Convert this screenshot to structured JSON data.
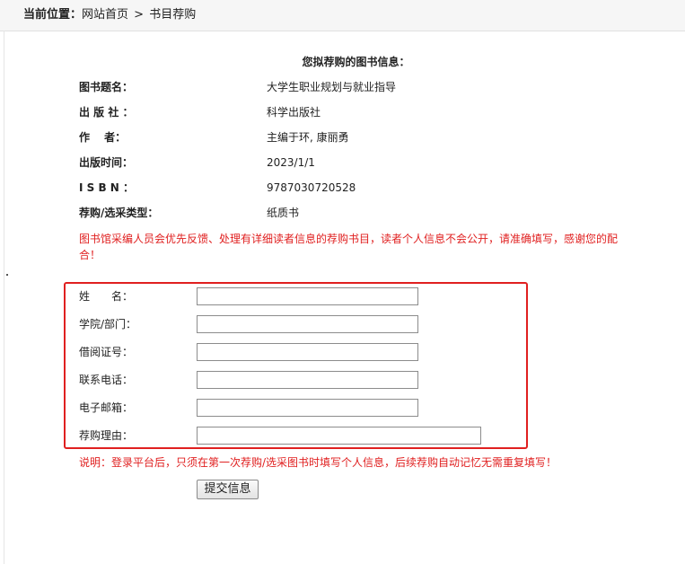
{
  "breadcrumb": {
    "label": "当前位置：",
    "home": "网站首页",
    "separator": ">",
    "current": "书目荐购"
  },
  "book_info": {
    "title": "您拟荐购的图书信息：",
    "rows": [
      {
        "label": "图书题名：",
        "value": "大学生职业规划与就业指导"
      },
      {
        "label": "出 版 社 ：",
        "value": "科学出版社"
      },
      {
        "label": "作　 者：",
        "value": "主编于环, 康丽勇"
      },
      {
        "label": "出版时间：",
        "value": "2023/1/1"
      },
      {
        "label": "I S B N ：",
        "value": "9787030720528"
      },
      {
        "label": "荐购/选采类型：",
        "value": "纸质书"
      }
    ]
  },
  "notice": "图书馆采编人员会优先反馈、处理有详细读者信息的荐购书目，读者个人信息不会公开，请准确填写，感谢您的配合！",
  "form": {
    "fields": [
      {
        "label": "姓　　名：",
        "value": "",
        "placeholder": ""
      },
      {
        "label": "学院/部门：",
        "value": "",
        "placeholder": ""
      },
      {
        "label": "借阅证号：",
        "value": "",
        "placeholder": ""
      },
      {
        "label": "联系电话：",
        "value": "",
        "placeholder": ""
      },
      {
        "label": "电子邮箱：",
        "value": "",
        "placeholder": ""
      },
      {
        "label": "荐购理由：",
        "value": "",
        "placeholder": ""
      }
    ],
    "highlight_color": "#e02020"
  },
  "tip": "说明：登录平台后，只须在第一次荐购/选采图书时填写个人信息，后续荐购自动记忆无需重复填写！",
  "submit_label": "提交信息",
  "colors": {
    "accent_red": "#e02020",
    "breadcrumb_bg": "#f6f6f6"
  }
}
